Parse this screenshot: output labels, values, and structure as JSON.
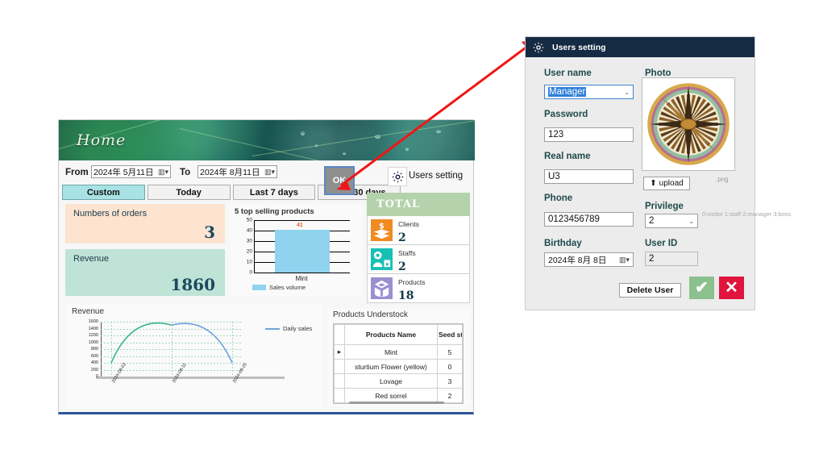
{
  "dashboard": {
    "banner_title": "Home",
    "filter": {
      "from_label": "From",
      "from_value": "2024年 5月11日",
      "to_label": "To",
      "to_value": "2024年 8月11日",
      "ok_label": "OK",
      "quick_buttons": [
        {
          "label": "Custom",
          "active": true
        },
        {
          "label": "Today",
          "active": false
        },
        {
          "label": "Last 7 days",
          "active": false
        },
        {
          "label": "Last 30 days",
          "active": false
        }
      ]
    },
    "users_setting_link": "Users setting",
    "kpis": [
      {
        "name": "Numbers of orders",
        "value": "3",
        "color": "#fce4d0"
      },
      {
        "name": "Revenue",
        "value": "1860",
        "color": "#bfe3d6"
      }
    ],
    "total_panel": {
      "title": "TOTAL",
      "rows": [
        {
          "name": "Clients",
          "value": "2",
          "icon": "clients-icon",
          "color": "#f08a22"
        },
        {
          "name": "Staffs",
          "value": "2",
          "icon": "staff-icon",
          "color": "#17bfb5"
        },
        {
          "name": "Products",
          "value": "18",
          "icon": "products-icon",
          "color": "#9b8fd1"
        }
      ]
    },
    "understock": {
      "title": "Products Understock",
      "columns": [
        "",
        "Products Name",
        "Seed stock"
      ],
      "rows": [
        {
          "mark": "▸",
          "name": "Mint",
          "seed": "5"
        },
        {
          "mark": "",
          "name": "sturtium Flower (yellow)",
          "seed": "0"
        },
        {
          "mark": "",
          "name": "Lovage",
          "seed": "3"
        },
        {
          "mark": "",
          "name": "Red sorrel",
          "seed": "2"
        }
      ]
    }
  },
  "chart_data": [
    {
      "type": "bar",
      "title": "5 top selling products",
      "categories": [
        "Mint"
      ],
      "values": [
        41
      ],
      "data_labels": [
        "41"
      ],
      "legend": [
        "Sales volume"
      ],
      "legend_position": "bottom-left",
      "ylabel": "",
      "xlabel": "",
      "ylim": [
        0,
        50
      ],
      "yticks": [
        0,
        10,
        20,
        30,
        40,
        50
      ],
      "grid": true,
      "series_color": "#8fd3ef"
    },
    {
      "type": "line",
      "title": "Revenue",
      "x": [
        "2024-08-02",
        "2024-08-11",
        "2024-08-25"
      ],
      "series": [
        {
          "name": "Daily sales",
          "values": [
            400,
            1500,
            400
          ],
          "color": "#6aa3dd"
        }
      ],
      "legend": [
        "Daily sales"
      ],
      "legend_position": "right",
      "ylim": [
        0,
        1600
      ],
      "yticks": [
        0,
        200,
        400,
        600,
        800,
        1000,
        1200,
        1400,
        1600
      ],
      "grid": true,
      "xlabel": "",
      "ylabel": ""
    }
  ],
  "dialog": {
    "title": "Users setting",
    "fields": {
      "user_name_label": "User name",
      "user_name_value": "Manager",
      "password_label": "Password",
      "password_value": "123",
      "real_name_label": "Real name",
      "real_name_value": "U3",
      "phone_label": "Phone",
      "phone_value": "0123456789",
      "birthday_label": "Birthday",
      "birthday_value": "2024年 8月 8日",
      "photo_label": "Photo",
      "upload_label": "upload",
      "png_label": ".png",
      "privilege_label": "Privilege",
      "privilege_value": "2",
      "privilege_hint": "0:visitor\n1:staff\n2:manager\n3:boss",
      "user_id_label": "User ID",
      "user_id_value": "2"
    },
    "buttons": {
      "delete_label": "Delete User",
      "confirm_icon": "check-icon",
      "cancel_icon": "close-icon"
    },
    "colors": {
      "titlebar": "#152a43",
      "confirm": "#8cc08c",
      "cancel": "#e0143c"
    }
  }
}
